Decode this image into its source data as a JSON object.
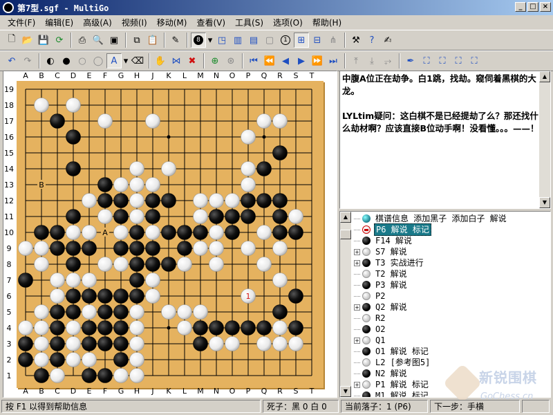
{
  "window": {
    "title": "第7型.sgf - MultiGo"
  },
  "menu": [
    "文件(F)",
    "编辑(E)",
    "高级(A)",
    "视频(I)",
    "移动(M)",
    "查看(V)",
    "工具(S)",
    "选项(O)",
    "帮助(H)"
  ],
  "board": {
    "size": 19,
    "columns": [
      "A",
      "B",
      "C",
      "D",
      "E",
      "F",
      "G",
      "H",
      "J",
      "K",
      "L",
      "M",
      "N",
      "O",
      "P",
      "Q",
      "R",
      "S",
      "T"
    ],
    "rows": [
      "19",
      "18",
      "17",
      "16",
      "15",
      "14",
      "13",
      "12",
      "11",
      "10",
      "9",
      "8",
      "7",
      "6",
      "5",
      "4",
      "3",
      "2",
      "1"
    ],
    "grid_rows": [
      ".....W.............",
      "...B...W..W......W.",
      "....B.........W....",
      "..................B.",
      "....B...W.W...WB...",
      ".......BWW.....W...",
      "....W.BBWBB..WWBBB.",
      "....B.W.WBB..W.BB.W",
      ".BBW.WBWBBB.BWB.BWB",
      "WWBBB.BBBWBWBBBW.BW",
      "..WB.WWBBBWWB..W.W.",
      "B..W.W....BW.......",
      "...W.BB....B..W...B.",
      "..WBB.B....B.......",
      "..WBBBB..WWB.....B.",
      "..BBBBBWBBBBBBBBBBB",
      "..BWB.BW....BWW.WWW",
      "..BWB.BB.........",
      "..BWBBBWW.........."
    ],
    "stones": [
      [
        "Q",
        17,
        "W"
      ],
      [
        "B",
        18,
        "W"
      ],
      [
        "D",
        18,
        "W"
      ],
      [
        "J",
        17,
        "W"
      ],
      [
        "C",
        17,
        "B"
      ],
      [
        "F",
        17,
        "W"
      ],
      [
        "R",
        17,
        "W"
      ],
      [
        "D",
        16,
        "B"
      ],
      [
        "P",
        16,
        "W"
      ],
      [
        "R",
        15,
        "B"
      ],
      [
        "D",
        14,
        "B"
      ],
      [
        "H",
        14,
        "W"
      ],
      [
        "K",
        14,
        "W"
      ],
      [
        "P",
        14,
        "W"
      ],
      [
        "Q",
        14,
        "B"
      ],
      [
        "F",
        13,
        "B"
      ],
      [
        "G",
        13,
        "W"
      ],
      [
        "H",
        13,
        "W"
      ],
      [
        "J",
        13,
        "W"
      ],
      [
        "P",
        13,
        "W"
      ],
      [
        "E",
        12,
        "W"
      ],
      [
        "F",
        12,
        "B"
      ],
      [
        "G",
        12,
        "B"
      ],
      [
        "H",
        12,
        "W"
      ],
      [
        "J",
        12,
        "B"
      ],
      [
        "K",
        12,
        "B"
      ],
      [
        "M",
        12,
        "W"
      ],
      [
        "N",
        12,
        "W"
      ],
      [
        "O",
        12,
        "W"
      ],
      [
        "P",
        12,
        "B"
      ],
      [
        "Q",
        12,
        "B"
      ],
      [
        "R",
        12,
        "B"
      ],
      [
        "D",
        11,
        "B"
      ],
      [
        "F",
        11,
        "W"
      ],
      [
        "G",
        11,
        "B"
      ],
      [
        "H",
        11,
        "W"
      ],
      [
        "J",
        11,
        "B"
      ],
      [
        "M",
        11,
        "W"
      ],
      [
        "N",
        11,
        "B"
      ],
      [
        "O",
        11,
        "B"
      ],
      [
        "P",
        11,
        "B"
      ],
      [
        "R",
        11,
        "B"
      ],
      [
        "S",
        11,
        "W"
      ],
      [
        "B",
        10,
        "B"
      ],
      [
        "C",
        10,
        "B"
      ],
      [
        "D",
        10,
        "W"
      ],
      [
        "E",
        10,
        "W"
      ],
      [
        "G",
        10,
        "W"
      ],
      [
        "H",
        10,
        "B"
      ],
      [
        "J",
        10,
        "W"
      ],
      [
        "K",
        10,
        "B"
      ],
      [
        "L",
        10,
        "B"
      ],
      [
        "M",
        10,
        "B"
      ],
      [
        "N",
        10,
        "W"
      ],
      [
        "O",
        10,
        "B"
      ],
      [
        "Q",
        10,
        "W"
      ],
      [
        "R",
        10,
        "B"
      ],
      [
        "S",
        10,
        "B"
      ],
      [
        "A",
        9,
        "W"
      ],
      [
        "B",
        9,
        "W"
      ],
      [
        "C",
        9,
        "B"
      ],
      [
        "D",
        9,
        "B"
      ],
      [
        "E",
        9,
        "B"
      ],
      [
        "G",
        9,
        "B"
      ],
      [
        "H",
        9,
        "B"
      ],
      [
        "J",
        9,
        "B"
      ],
      [
        "L",
        9,
        "B"
      ],
      [
        "M",
        9,
        "W"
      ],
      [
        "N",
        9,
        "W"
      ],
      [
        "P",
        9,
        "W"
      ],
      [
        "R",
        9,
        "W"
      ],
      [
        "B",
        8,
        "W"
      ],
      [
        "D",
        8,
        "B"
      ],
      [
        "F",
        8,
        "W"
      ],
      [
        "G",
        8,
        "W"
      ],
      [
        "H",
        8,
        "B"
      ],
      [
        "J",
        8,
        "B"
      ],
      [
        "K",
        8,
        "B"
      ],
      [
        "L",
        8,
        "W"
      ],
      [
        "N",
        8,
        "W"
      ],
      [
        "Q",
        8,
        "W"
      ],
      [
        "A",
        7,
        "B"
      ],
      [
        "C",
        7,
        "W"
      ],
      [
        "D",
        7,
        "W"
      ],
      [
        "E",
        7,
        "W"
      ],
      [
        "H",
        7,
        "B"
      ],
      [
        "J",
        7,
        "W"
      ],
      [
        "R",
        7,
        "W"
      ],
      [
        "C",
        6,
        "W"
      ],
      [
        "D",
        6,
        "B"
      ],
      [
        "E",
        6,
        "B"
      ],
      [
        "F",
        6,
        "B"
      ],
      [
        "G",
        6,
        "B"
      ],
      [
        "H",
        6,
        "B"
      ],
      [
        "J",
        6,
        "W"
      ],
      [
        "P",
        6,
        "W"
      ],
      [
        "S",
        6,
        "B"
      ],
      [
        "B",
        5,
        "W"
      ],
      [
        "C",
        5,
        "B"
      ],
      [
        "D",
        5,
        "B"
      ],
      [
        "E",
        5,
        "W"
      ],
      [
        "F",
        5,
        "B"
      ],
      [
        "G",
        5,
        "B"
      ],
      [
        "H",
        5,
        "W"
      ],
      [
        "K",
        5,
        "W"
      ],
      [
        "L",
        5,
        "W"
      ],
      [
        "M",
        5,
        "W"
      ],
      [
        "R",
        5,
        "B"
      ],
      [
        "A",
        4,
        "W"
      ],
      [
        "B",
        4,
        "W"
      ],
      [
        "C",
        4,
        "B"
      ],
      [
        "D",
        4,
        "W"
      ],
      [
        "E",
        4,
        "B"
      ],
      [
        "F",
        4,
        "B"
      ],
      [
        "G",
        4,
        "B"
      ],
      [
        "H",
        4,
        "W"
      ],
      [
        "L",
        4,
        "W"
      ],
      [
        "M",
        4,
        "B"
      ],
      [
        "N",
        4,
        "B"
      ],
      [
        "O",
        4,
        "B"
      ],
      [
        "P",
        4,
        "B"
      ],
      [
        "Q",
        4,
        "B"
      ],
      [
        "R",
        4,
        "W"
      ],
      [
        "S",
        4,
        "B"
      ],
      [
        "A",
        3,
        "B"
      ],
      [
        "B",
        3,
        "W"
      ],
      [
        "C",
        3,
        "B"
      ],
      [
        "D",
        3,
        "W"
      ],
      [
        "E",
        3,
        "B"
      ],
      [
        "F",
        3,
        "B"
      ],
      [
        "G",
        3,
        "B"
      ],
      [
        "H",
        3,
        "W"
      ],
      [
        "M",
        3,
        "B"
      ],
      [
        "N",
        3,
        "W"
      ],
      [
        "O",
        3,
        "W"
      ],
      [
        "Q",
        3,
        "W"
      ],
      [
        "R",
        3,
        "W"
      ],
      [
        "S",
        3,
        "W"
      ],
      [
        "A",
        2,
        "B"
      ],
      [
        "B",
        2,
        "W"
      ],
      [
        "C",
        2,
        "B"
      ],
      [
        "D",
        2,
        "W"
      ],
      [
        "E",
        2,
        "W"
      ],
      [
        "G",
        2,
        "B"
      ],
      [
        "H",
        2,
        "W"
      ],
      [
        "B",
        1,
        "B"
      ],
      [
        "C",
        1,
        "W"
      ],
      [
        "E",
        1,
        "B"
      ],
      [
        "F",
        1,
        "B"
      ],
      [
        "G",
        1,
        "W"
      ],
      [
        "H",
        1,
        "W"
      ]
    ],
    "markers": [
      [
        "B",
        13,
        "B"
      ],
      [
        "F",
        10,
        "A"
      ]
    ],
    "last_move": {
      "point": [
        "P",
        6
      ],
      "label": "1"
    },
    "hoshi": [
      [
        "D",
        16
      ],
      [
        "K",
        16
      ],
      [
        "Q",
        16
      ],
      [
        "D",
        10
      ],
      [
        "K",
        10
      ],
      [
        "Q",
        10
      ],
      [
        "D",
        4
      ],
      [
        "K",
        4
      ],
      [
        "Q",
        4
      ]
    ]
  },
  "comment": {
    "paragraphs": [
      "中腹A位正在劫争。白1跳，找劫。窥伺着黑棋的大龙。",
      "LYLtim疑问：这白棋不是已经提劫了么？那还找什么劫材啊？应该直接B位动手啊！没看懂。。。——！"
    ]
  },
  "tree": {
    "items": [
      {
        "exp": "none",
        "stone": "teal",
        "label": "棋谱信息 添加黑子 添加白子 解说"
      },
      {
        "exp": "none",
        "stone": "red",
        "label": "P6 解说 标记",
        "selected": true
      },
      {
        "exp": "none",
        "stone": "b",
        "label": "F14 解说"
      },
      {
        "exp": "plus",
        "stone": "w",
        "label": "S7 解说"
      },
      {
        "exp": "plus",
        "stone": "b",
        "label": "T3 实战进行"
      },
      {
        "exp": "none",
        "stone": "w",
        "label": "T2 解说"
      },
      {
        "exp": "none",
        "stone": "b",
        "label": "P3 解说"
      },
      {
        "exp": "none",
        "stone": "w",
        "label": "P2"
      },
      {
        "exp": "plus",
        "stone": "b",
        "label": "Q2 解说"
      },
      {
        "exp": "none",
        "stone": "w",
        "label": "R2"
      },
      {
        "exp": "none",
        "stone": "b",
        "label": "O2"
      },
      {
        "exp": "plus",
        "stone": "w",
        "label": "Q1"
      },
      {
        "exp": "none",
        "stone": "b",
        "label": "O1 解说 标记"
      },
      {
        "exp": "none",
        "stone": "w",
        "label": "L2 [参考图5]"
      },
      {
        "exp": "none",
        "stone": "b",
        "label": "N2 解说"
      },
      {
        "exp": "plus",
        "stone": "w",
        "label": "P1 解说 标记"
      },
      {
        "exp": "none",
        "stone": "b",
        "label": "M1 解说 标记"
      }
    ]
  },
  "status": {
    "help": "按 F1 以得到帮助信息",
    "captures": "死子：黑 0 白 0",
    "current": "当前落子：1 (P6)",
    "next": "下一步：手横"
  },
  "watermark": {
    "name": "新锐围棋",
    "url": "GoChess.cn"
  }
}
